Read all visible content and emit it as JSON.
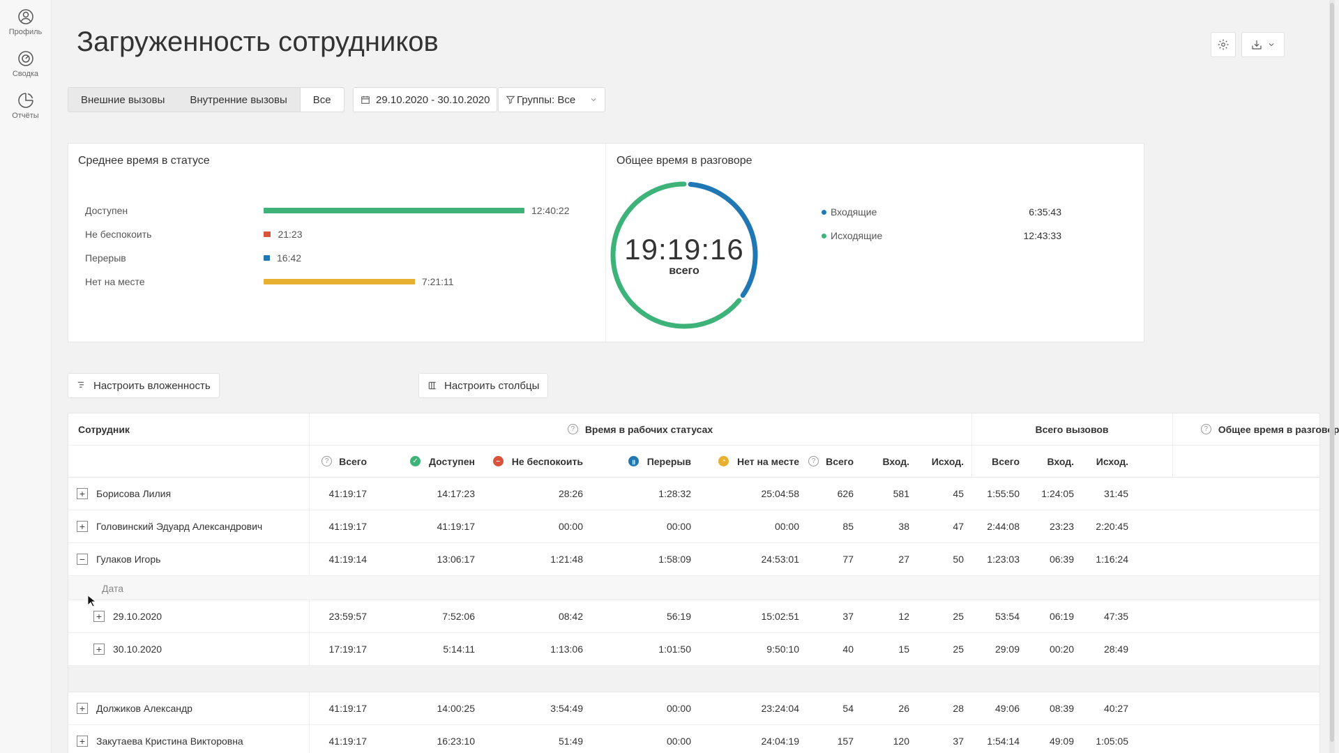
{
  "sidebar": {
    "items": [
      {
        "label": "Профиль",
        "icon": "user-icon"
      },
      {
        "label": "Сводка",
        "icon": "dashboard-icon"
      },
      {
        "label": "Отчёты",
        "icon": "reports-icon"
      }
    ]
  },
  "header": {
    "title": "Загруженность сотрудников"
  },
  "filters": {
    "tabs": [
      "Внешние вызовы",
      "Внутренние вызовы",
      "Все"
    ],
    "active_tab": "Все",
    "date_range": "29.10.2020 - 30.10.2020",
    "groups": "Группы: Все"
  },
  "summary": {
    "avg_status_title": "Среднее время в статусе",
    "statuses": [
      {
        "label": "Доступен",
        "value": "12:40:22",
        "fraction": 1.0,
        "color": "#3db37a"
      },
      {
        "label": "Не беспокоить",
        "value": "21:23",
        "fraction": 0.028,
        "color": "#d9533a"
      },
      {
        "label": "Перерыв",
        "value": "16:42",
        "fraction": 0.022,
        "color": "#1f77b4"
      },
      {
        "label": "Нет на месте",
        "value": "7:21:11",
        "fraction": 0.58,
        "color": "#e8b030"
      }
    ],
    "talk_title": "Общее время в разговоре",
    "talk_total": "19:19:16",
    "talk_total_label": "всего",
    "talk_series": [
      {
        "label": "Входящие",
        "value": "6:35:43",
        "fraction": 0.341,
        "color": "#1f77b4"
      },
      {
        "label": "Исходящие",
        "value": "12:43:33",
        "fraction": 0.659,
        "color": "#3db37a"
      }
    ]
  },
  "tools": {
    "nesting": "Настроить вложенность",
    "columns": "Настроить столбцы"
  },
  "table": {
    "employee_header": "Сотрудник",
    "group_status": "Время в рабочих статусах",
    "group_calls": "Всего вызовов",
    "group_talk": "Общее время в разговоре",
    "cols": {
      "total": "Всего",
      "available": "Доступен",
      "dnd": "Не беспокоить",
      "break": "Перерыв",
      "away": "Нет на месте",
      "calls_total": "Всего",
      "calls_in": "Вход.",
      "calls_out": "Исход.",
      "talk_total": "Всего",
      "talk_in": "Вход.",
      "talk_out": "Исход."
    },
    "sub_header": "Дата",
    "rows": [
      {
        "name": "Борисова Лилия",
        "expanded": false,
        "v": [
          "41:19:17",
          "14:17:23",
          "28:26",
          "1:28:32",
          "25:04:58",
          "626",
          "581",
          "45",
          "1:55:50",
          "1:24:05",
          "31:45"
        ]
      },
      {
        "name": "Головинский Эдуард Александрович",
        "expanded": false,
        "v": [
          "41:19:17",
          "41:19:17",
          "00:00",
          "00:00",
          "00:00",
          "85",
          "38",
          "47",
          "2:44:08",
          "23:23",
          "2:20:45"
        ]
      },
      {
        "name": "Гулаков Игорь",
        "expanded": true,
        "v": [
          "41:19:14",
          "13:06:17",
          "1:21:48",
          "1:58:09",
          "24:53:01",
          "77",
          "27",
          "50",
          "1:23:03",
          "06:39",
          "1:16:24"
        ]
      }
    ],
    "sub_rows": [
      {
        "name": "29.10.2020",
        "v": [
          "23:59:57",
          "7:52:06",
          "08:42",
          "56:19",
          "15:02:51",
          "37",
          "12",
          "25",
          "53:54",
          "06:19",
          "47:35"
        ]
      },
      {
        "name": "30.10.2020",
        "v": [
          "17:19:17",
          "5:14:11",
          "1:13:06",
          "1:01:50",
          "9:50:10",
          "40",
          "15",
          "25",
          "29:09",
          "00:20",
          "28:49"
        ]
      }
    ],
    "rows_after": [
      {
        "name": "Должиков Александр",
        "expanded": false,
        "v": [
          "41:19:17",
          "14:00:25",
          "3:54:49",
          "00:00",
          "23:24:04",
          "54",
          "26",
          "28",
          "49:06",
          "08:39",
          "40:27"
        ]
      },
      {
        "name": "Закутаева Кристина Викторовна",
        "expanded": false,
        "v": [
          "41:19:17",
          "16:23:10",
          "51:49",
          "00:00",
          "24:04:19",
          "157",
          "120",
          "37",
          "1:54:14",
          "49:09",
          "1:05:05"
        ]
      }
    ]
  }
}
